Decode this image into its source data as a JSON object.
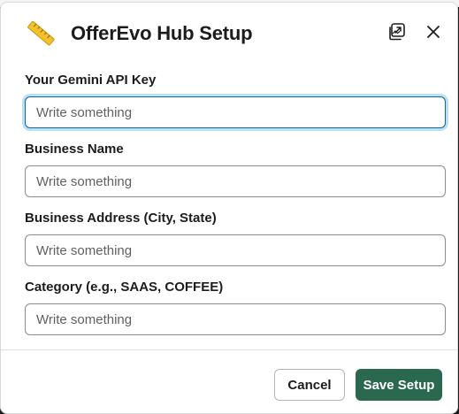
{
  "modal": {
    "title": "OfferEvo Hub Setup",
    "app_icon": "ruler-icon",
    "popout_icon": "popout-icon",
    "close_icon": "close-icon"
  },
  "fields": [
    {
      "label": "Your Gemini API Key",
      "value": "",
      "placeholder": "Write something"
    },
    {
      "label": "Business Name",
      "value": "",
      "placeholder": "Write something"
    },
    {
      "label": "Business Address (City, State)",
      "value": "",
      "placeholder": "Write something"
    },
    {
      "label": "Category (e.g., SAAS, COFFEE)",
      "value": "",
      "placeholder": "Write something"
    }
  ],
  "footer": {
    "cancel_label": "Cancel",
    "save_label": "Save Setup"
  },
  "colors": {
    "primary_button": "#2a6850",
    "focus_border": "#1264a3",
    "app_icon_yellow": "#f2c12e"
  }
}
